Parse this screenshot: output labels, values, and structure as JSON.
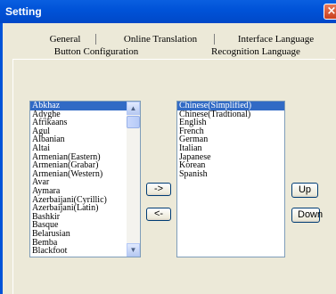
{
  "window": {
    "title": "Setting"
  },
  "icons": {
    "close": "close-icon",
    "scroll_up": "scroll-up-arrow-icon",
    "scroll_down": "scroll-down-arrow-icon"
  },
  "tabs": {
    "row1": [
      "General",
      "Online Translation",
      "Interface Language"
    ],
    "row2": [
      "Button Configuration",
      "Recognition Language"
    ],
    "active": "Recognition Language"
  },
  "available_languages": {
    "items": [
      "Abkhaz",
      "Adyghe",
      "Afrikaans",
      "Agul",
      "Albanian",
      "Altai",
      "Armenian(Eastern)",
      "Armenian(Grabar)",
      "Armenian(Western)",
      "Avar",
      "Aymara",
      "Azerbaijani(Cyrillic)",
      "Azerbaijani(Latin)",
      "Bashkir",
      "Basque",
      "Belarusian",
      "Bemba",
      "Blackfoot"
    ],
    "selected": "Abkhaz"
  },
  "selected_languages": {
    "items": [
      "Chinese(Simplified)",
      "Chinese(Tradtional)",
      "English",
      "French",
      "German",
      "Italian",
      "Japanese",
      "Korean",
      "Spanish"
    ],
    "selected": "Chinese(Simplified)"
  },
  "buttons": {
    "add": "->",
    "remove": "<-",
    "up": "Up",
    "down": "Down"
  },
  "colors": {
    "titlebar": "#0053d8",
    "selection": "#316ac5",
    "dialog_bg": "#ece9d8"
  }
}
